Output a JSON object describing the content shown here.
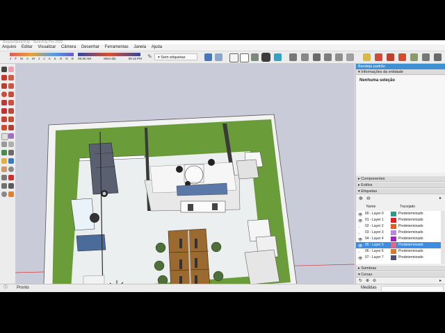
{
  "window": {
    "title": "ArquivoSketchUp - SketchUp Pro 2020"
  },
  "menu": [
    "Arquivo",
    "Editar",
    "Visualizar",
    "Câmera",
    "Desenhar",
    "Ferramentas",
    "Janela",
    "Ajuda"
  ],
  "shadow_bar": {
    "months": [
      "J",
      "F",
      "M",
      "A",
      "M",
      "J",
      "J",
      "A",
      "S",
      "O",
      "N",
      "D"
    ],
    "time_start": "06:30 AM",
    "time_mid": "Meio-dia",
    "time_end": "05:15 PM"
  },
  "tag_selector": {
    "value": "Sem etiquetas"
  },
  "tray": {
    "title": "Bandeja padrão",
    "entity_info": {
      "header": "Informações da entidade",
      "text": "Nenhuma seleção"
    },
    "panels": [
      "Componentes",
      "Estilos",
      "Etiquetas"
    ],
    "tags_columns": {
      "name": "Nome",
      "style": "Tracejado"
    },
    "tags": [
      {
        "name": "00 - Layer 0",
        "style": "Predeterminado",
        "color": "#2c9a8a",
        "visible": true
      },
      {
        "name": "01 - Layer 1",
        "style": "Predeterminado",
        "color": "#e02020",
        "visible": true
      },
      {
        "name": "02 - Layer 2",
        "style": "Predeterminado",
        "color": "#e06020",
        "visible": false
      },
      {
        "name": "03 - Layer 3",
        "style": "Predeterminado",
        "color": "#b08ad8",
        "visible": false
      },
      {
        "name": "04 - Layer 4",
        "style": "Predeterminado",
        "color": "#a020c0",
        "visible": true
      },
      {
        "name": "05 - Layer 5",
        "style": "Predeterminado",
        "color": "#d86a8a",
        "visible": true,
        "selected": true
      },
      {
        "name": "06 - Layer 6",
        "style": "Predeterminado",
        "color": "#e07820",
        "visible": false
      },
      {
        "name": "07 - Layer 7",
        "style": "Predeterminado",
        "color": "#505070",
        "visible": true
      }
    ],
    "bottom_panels": [
      "Sombras",
      "Cenas"
    ]
  },
  "status": {
    "left": "Pronto",
    "right": "Medidas"
  },
  "colors": {
    "floor_green": "#6b9c3a",
    "wall_white": "#f4f4f4",
    "wood_desk": "#9a6a30",
    "chair_green": "#4f6f3a",
    "select_blue": "#3d8ee0"
  }
}
